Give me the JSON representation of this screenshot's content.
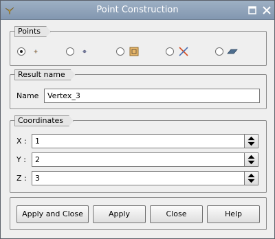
{
  "window": {
    "title": "Point Construction"
  },
  "icons": {
    "app": "app-logo-icon",
    "maximize": "maximize-icon",
    "close": "close-icon"
  },
  "points": {
    "label": "Points",
    "options": [
      {
        "icon": "point-coordinates-icon",
        "checked": true
      },
      {
        "icon": "point-on-edge-icon",
        "checked": false
      },
      {
        "icon": "point-on-face-icon",
        "checked": false
      },
      {
        "icon": "point-intersection-icon",
        "checked": false
      },
      {
        "icon": "point-on-plane-icon",
        "checked": false
      }
    ]
  },
  "result": {
    "label": "Result name",
    "name_label": "Name",
    "name_value": "Vertex_3"
  },
  "coordinates": {
    "label": "Coordinates",
    "x_label": "X :",
    "x_value": "1",
    "y_label": "Y :",
    "y_value": "2",
    "z_label": "Z :",
    "z_value": "3"
  },
  "buttons": {
    "apply_close": "Apply and Close",
    "apply": "Apply",
    "close": "Close",
    "help": "Help"
  }
}
